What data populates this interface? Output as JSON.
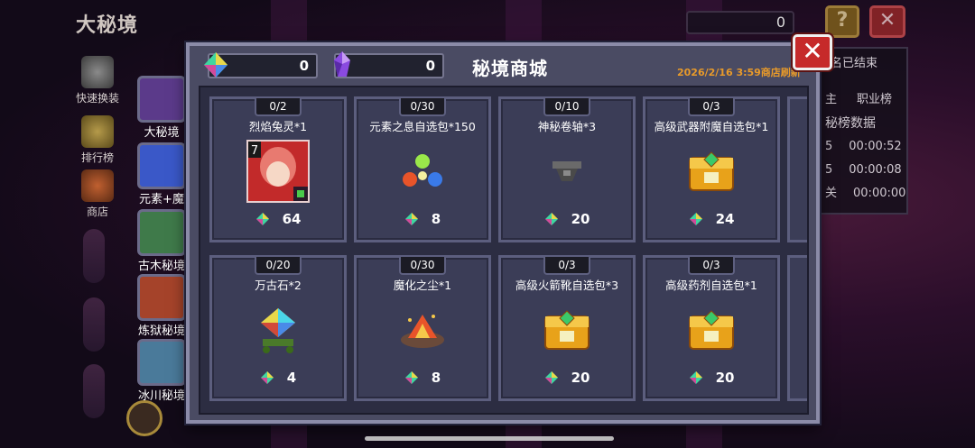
{
  "scene": {
    "title": "大秘境",
    "side_buttons": [
      {
        "label": "快速换装",
        "icon": "armor-swap-icon"
      },
      {
        "label": "排行榜",
        "icon": "trophy-icon"
      },
      {
        "label": "商店",
        "icon": "shop-icon"
      }
    ],
    "dungeons": [
      {
        "label": "大秘境",
        "color": "#5b3a8a"
      },
      {
        "label": "元素+魔王",
        "color": "#3a58c8"
      },
      {
        "label": "古木秘境",
        "color": "#3f7a4a"
      },
      {
        "label": "炼狱秘境",
        "color": "#a5432a"
      },
      {
        "label": "冰川秘境",
        "color": "#4a7a9a"
      }
    ],
    "top_counter": "0",
    "help_label": "?",
    "close_label": "✕",
    "rank_panel": {
      "partial_header": "名已结束",
      "tab_partial": "主",
      "tab_job": "职业榜",
      "sub_header": "秘榜数据",
      "rows": [
        {
          "left": "5",
          "time": "00:00:52"
        },
        {
          "left": "5",
          "time": "00:00:08"
        },
        {
          "left": "关",
          "time": "00:00:00"
        }
      ]
    }
  },
  "shop": {
    "title": "秘境商城",
    "refresh_text": "2026/2/16 3:59商店刷新",
    "close_label": "✕",
    "currencies": [
      {
        "icon": "rainbow-gem-icon",
        "value": "0"
      },
      {
        "icon": "purple-crystal-icon",
        "value": "0"
      }
    ],
    "items": [
      {
        "stock": "0/2",
        "name": "烈焰兔灵*1",
        "price": "64",
        "icon": "flame-rabbit-spirit-icon"
      },
      {
        "stock": "0/30",
        "name": "元素之息自选包*150",
        "price": "8",
        "icon": "element-orbs-icon"
      },
      {
        "stock": "0/10",
        "name": "神秘卷轴*3",
        "price": "20",
        "icon": "scroll-icon"
      },
      {
        "stock": "0/3",
        "name": "高级武器附魔自选包*1",
        "price": "24",
        "icon": "golden-chest-icon"
      },
      {
        "stock": "0/20",
        "name": "万古石*2",
        "price": "4",
        "icon": "ancient-stone-icon"
      },
      {
        "stock": "0/30",
        "name": "魔化之尘*1",
        "price": "8",
        "icon": "demon-dust-icon"
      },
      {
        "stock": "0/3",
        "name": "高级火箭靴自选包*3",
        "price": "20",
        "icon": "golden-chest-icon"
      },
      {
        "stock": "0/3",
        "name": "高级药剂自选包*1",
        "price": "20",
        "icon": "golden-chest-icon"
      }
    ],
    "rabbit_level": "7"
  },
  "colors": {
    "modal_bg": "#4a4b63",
    "card_bg": "#3b3d57",
    "refresh_orange": "#e89a2a",
    "close_red": "#c62a2a"
  }
}
